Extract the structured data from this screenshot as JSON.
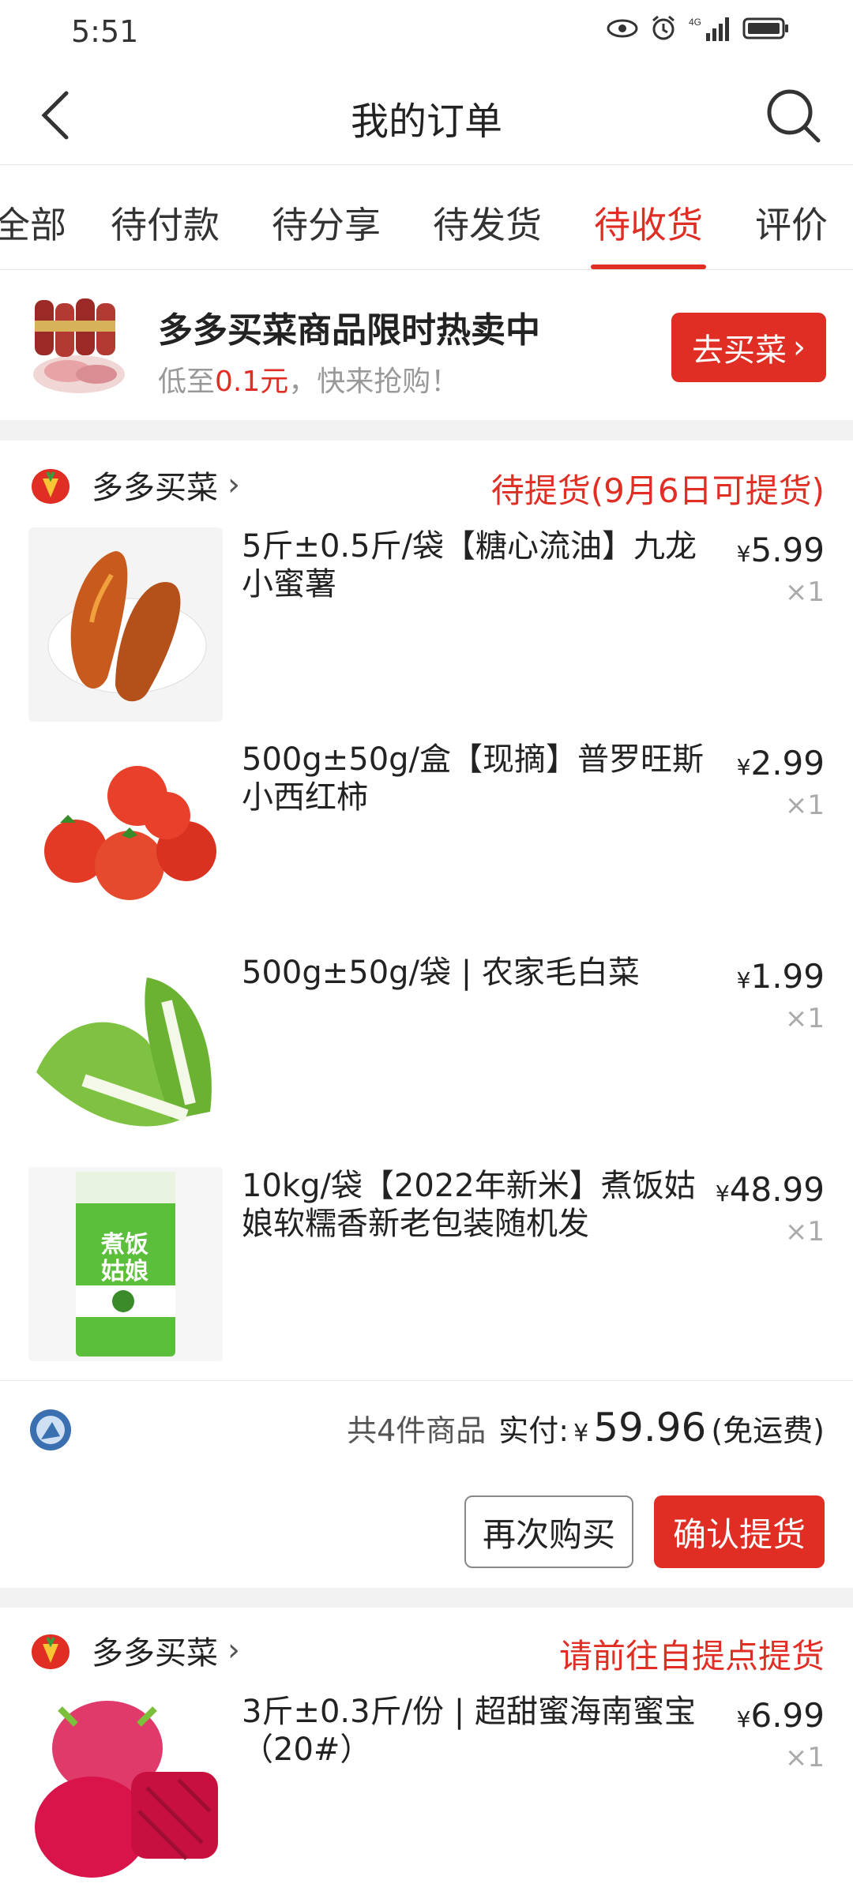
{
  "status_bar": {
    "time": "5:51",
    "icons": [
      "eye-icon",
      "alarm-icon",
      "signal-4g-icon",
      "battery-icon"
    ]
  },
  "header": {
    "title": "我的订单"
  },
  "tabs": [
    {
      "label": "全部"
    },
    {
      "label": "待付款"
    },
    {
      "label": "待分享"
    },
    {
      "label": "待发货"
    },
    {
      "label": "待收货",
      "active": true
    },
    {
      "label": "评价"
    }
  ],
  "promo": {
    "title": "多多买菜商品限时热卖中",
    "sub_prefix": "低至",
    "sub_price": "0.1元",
    "sub_suffix": "，快来抢购！",
    "button": "去买菜"
  },
  "orders": [
    {
      "store": "多多买菜",
      "status": "待提货(9月6日可提货)",
      "items": [
        {
          "name": "5斤±0.5斤/袋【糖心流油】九龙小蜜薯",
          "price": "5.99",
          "qty": "×1"
        },
        {
          "name": "500g±50g/盒【现摘】普罗旺斯小西红柿",
          "price": "2.99",
          "qty": "×1"
        },
        {
          "name": "500g±50g/袋 | 农家毛白菜",
          "price": "1.99",
          "qty": "×1"
        },
        {
          "name": "10kg/袋【2022年新米】煮饭姑娘软糯香新老包装随机发",
          "price": "48.99",
          "qty": "×1"
        }
      ],
      "summary": {
        "count_text": "共4件商品",
        "paid_label": "实付:",
        "currency": "¥",
        "amount": "59.96",
        "shipping": "(免运费)"
      },
      "buttons": {
        "rebuy": "再次购买",
        "confirm": "确认提货"
      }
    },
    {
      "store": "多多买菜",
      "status": "请前往自提点提货",
      "items": [
        {
          "name": "3斤±0.3斤/份 | 超甜蜜海南蜜宝（20#）",
          "price": "6.99",
          "qty": "×1"
        }
      ]
    }
  ],
  "currency_symbol": "¥",
  "rice_bag_text": {
    "brand": "煮饭姑娘",
    "line1": "煮饭",
    "line2": "姑娘"
  },
  "colors": {
    "accent": "#e02e24"
  }
}
